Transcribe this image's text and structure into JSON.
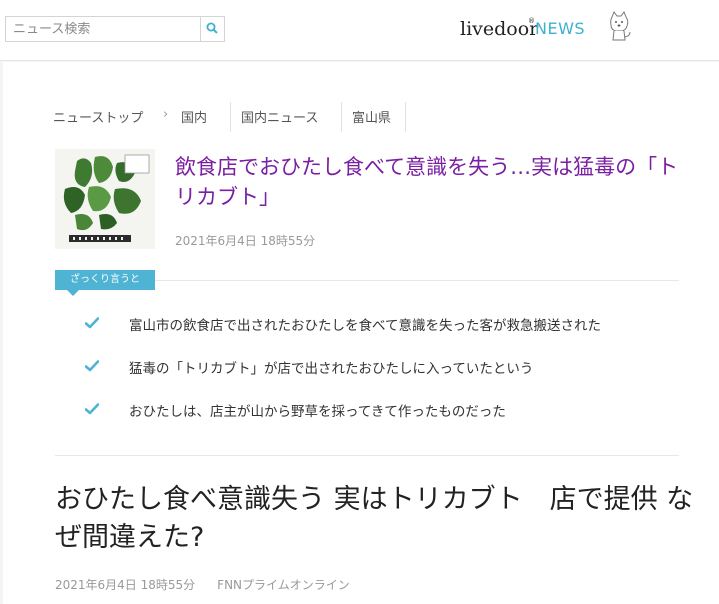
{
  "search": {
    "placeholder": "ニュース検索"
  },
  "brand": {
    "logo_main": "livedoor",
    "logo_mark": "®",
    "logo_news": "NEWS"
  },
  "breadcrumb": [
    {
      "label": "ニューストップ"
    },
    {
      "label": "国内"
    },
    {
      "label": "国内ニュース"
    },
    {
      "label": "富山県"
    }
  ],
  "article": {
    "headline": "飲食店でおひたし食べて意識を失う…実は猛毒の「トリカブト」",
    "date": "2021年6月4日 18時55分"
  },
  "summary": {
    "tag": "ざっくり言うと",
    "items": [
      "富山市の飲食店で出されたおひたしを食べて意識を失った客が救急搬送された",
      "猛毒の「トリカブト」が店で出されたおひたしに入っていたという",
      "おひたしは、店主が山から野草を採ってきて作ったものだった"
    ]
  },
  "story": {
    "title": "おひたし食べ意識失う 実はトリカブト　店で提供 なぜ間違えた?",
    "date": "2021年6月4日 18時55分",
    "source": "FNNプライムオンライン"
  },
  "colors": {
    "accent": "#4fb3d3",
    "headline": "#7b1fa2",
    "news": "#3eb0d0"
  }
}
